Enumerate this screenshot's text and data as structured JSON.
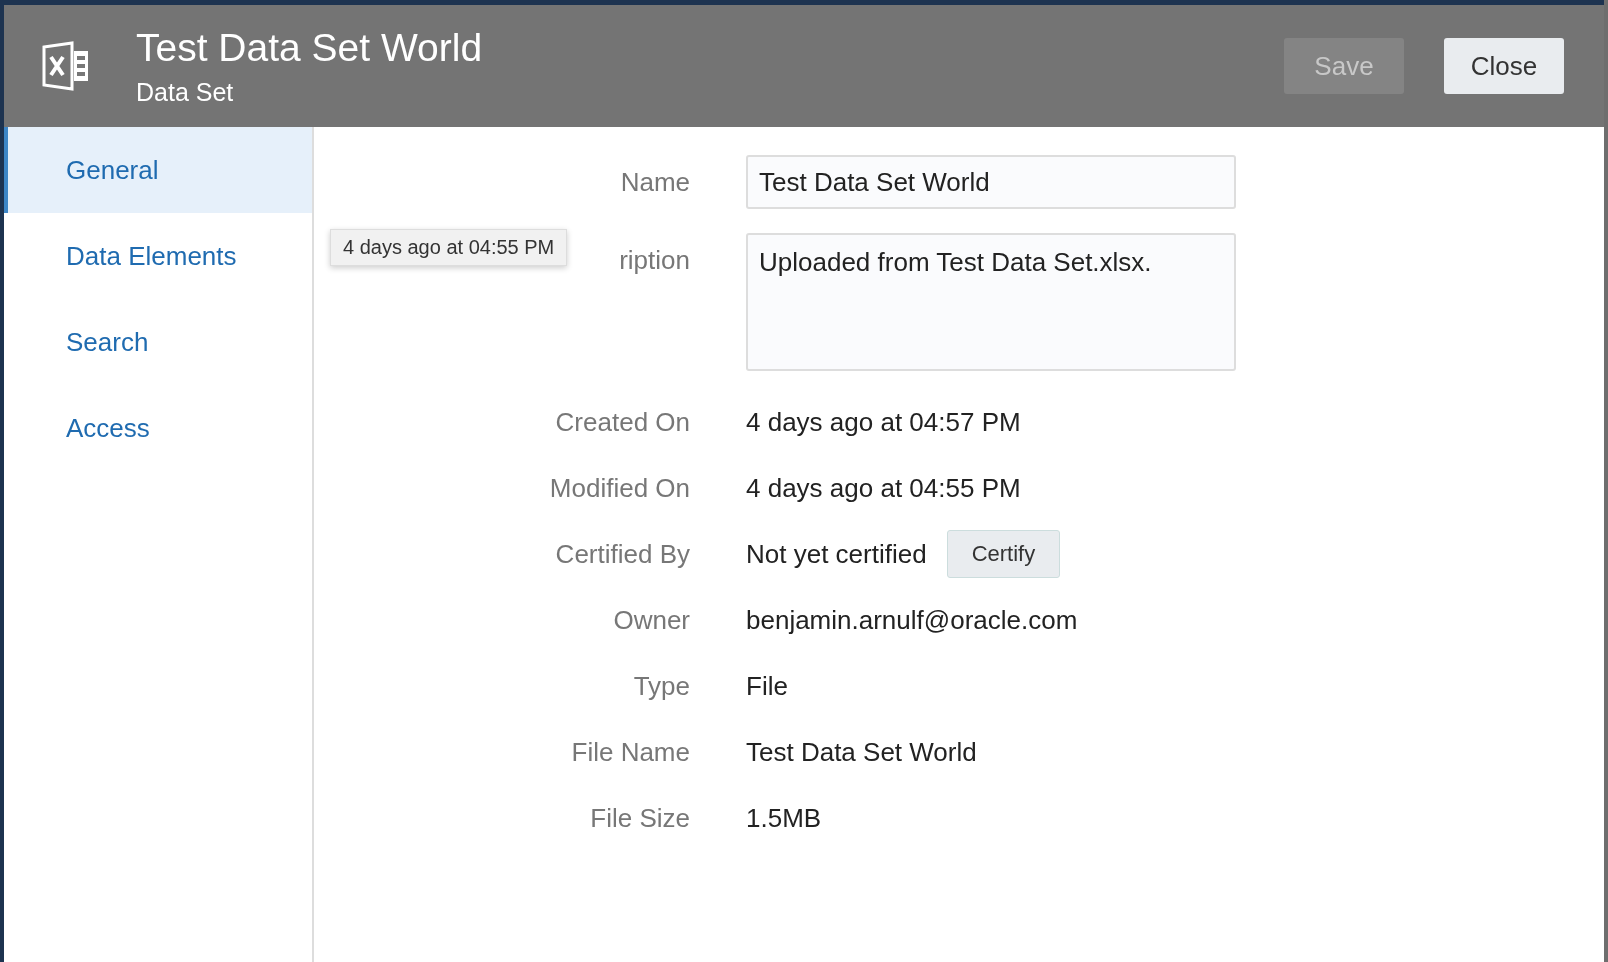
{
  "header": {
    "title": "Test Data Set World",
    "subtitle": "Data Set"
  },
  "buttons": [
    {
      "label": "Save",
      "disabled": true
    },
    {
      "label": "Close",
      "disabled": false
    }
  ],
  "sidebar": {
    "items": [
      {
        "label": "General",
        "selected": true
      },
      {
        "label": "Data Elements",
        "selected": false
      },
      {
        "label": "Search",
        "selected": false
      },
      {
        "label": "Access",
        "selected": false
      }
    ]
  },
  "form": {
    "name": {
      "label": "Name",
      "value": "Test Data Set World"
    },
    "description": {
      "label": "ription",
      "value": "Uploaded from Test Data Set.xlsx."
    },
    "tooltip": "4 days ago at 04:55 PM",
    "fields": [
      {
        "label": "Created On",
        "value": "4 days ago at 04:57 PM"
      },
      {
        "label": "Modified On",
        "value": "4 days ago at 04:55 PM"
      },
      {
        "label": "Certified By",
        "value": "Not yet certified",
        "action": "Certify"
      },
      {
        "label": "Owner",
        "value": "benjamin.arnulf@oracle.com"
      },
      {
        "label": "Type",
        "value": "File"
      },
      {
        "label": "File Name",
        "value": "Test Data Set World"
      },
      {
        "label": "File Size",
        "value": "1.5MB"
      }
    ]
  }
}
